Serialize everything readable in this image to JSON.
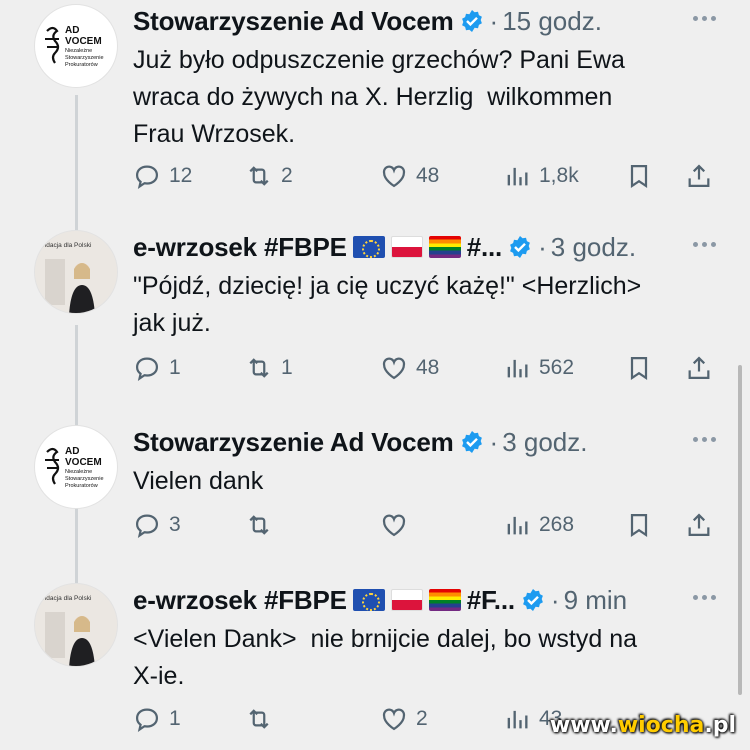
{
  "tweets": [
    {
      "author": "Stowarzyszenie Ad Vocem",
      "time": "15 godz.",
      "text": "Już było odpuszczenie grzechów? Pani Ewa\nwraca do żywych na X. Herzlig  wilkommen\nFrau Wrzosek.",
      "replies": "12",
      "reposts": "2",
      "likes": "48",
      "views": "1,8k",
      "logo": {
        "line1": "AD",
        "line2": "VOCEM",
        "line3": "Niezależne",
        "line4": "Stowarzyszenie",
        "line5": "Prokuratorów"
      }
    },
    {
      "author": "e-wrzosek #FBPE",
      "suffix": "#...",
      "time": "3 godz.",
      "text": "\"Pójdź, dziecię! ja cię uczyć każę!\" <Herzlich>\njak już.",
      "replies": "1",
      "reposts": "1",
      "likes": "48",
      "views": "562",
      "avatar_caption": "undacja dla Polski"
    },
    {
      "author": "Stowarzyszenie Ad Vocem",
      "time": "3 godz.",
      "text": "Vielen dank",
      "replies": "3",
      "reposts": "",
      "likes": "",
      "views": "268",
      "logo": {
        "line1": "AD",
        "line2": "VOCEM",
        "line3": "Niezależne",
        "line4": "Stowarzyszenie",
        "line5": "Prokuratorów"
      }
    },
    {
      "author": "e-wrzosek #FBPE",
      "suffix": "#F...",
      "time": "9 min",
      "text": "<Vielen Dank>  nie brnijcie dalej, bo wstyd na\nX-ie.",
      "replies": "1",
      "reposts": "",
      "likes": "2",
      "views": "43",
      "avatar_caption": "undacja dla Polski"
    }
  ],
  "separator": "·",
  "watermark": {
    "pre": "www.",
    "hl": "wiocha",
    "post": ".pl"
  },
  "icons": [
    "reply-icon",
    "repost-icon",
    "like-icon",
    "views-icon",
    "bookmark-icon",
    "share-icon",
    "verified-icon",
    "more-icon"
  ],
  "colors": {
    "verified": "#1d9bf0",
    "muted": "#536471",
    "background": "#efefef"
  }
}
